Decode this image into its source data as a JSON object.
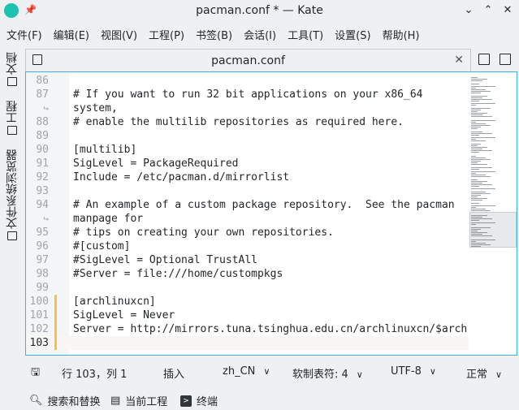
{
  "window": {
    "title": "pacman.conf * — Kate",
    "controls": [
      "minimize",
      "maximize",
      "close"
    ]
  },
  "menu": [
    "文件(F)",
    "编辑(E)",
    "视图(V)",
    "工程(P)",
    "书签(B)",
    "会话(I)",
    "工具(T)",
    "设置(S)",
    "帮助(H)"
  ],
  "sidebar": {
    "items": [
      {
        "label": "文档",
        "icon": "document-icon"
      },
      {
        "label": "工程",
        "icon": "project-icon"
      },
      {
        "label": "文件系统浏览器",
        "icon": "folder-icon"
      }
    ]
  },
  "tab": {
    "title": "pacman.conf",
    "close": "✕"
  },
  "editor": {
    "lines": [
      {
        "num": "86",
        "text": ""
      },
      {
        "num": "87",
        "text": "# If you want to run 32 bit applications on your x86_64"
      },
      {
        "num": "↪",
        "text": "system,",
        "wrap": true
      },
      {
        "num": "88",
        "text": "# enable the multilib repositories as required here."
      },
      {
        "num": "89",
        "text": ""
      },
      {
        "num": "90",
        "text": "[multilib]"
      },
      {
        "num": "91",
        "text": "SigLevel = PackageRequired"
      },
      {
        "num": "92",
        "text": "Include = /etc/pacman.d/mirrorlist"
      },
      {
        "num": "93",
        "text": ""
      },
      {
        "num": "94",
        "text": "# An example of a custom package repository.  See the pacman"
      },
      {
        "num": "↪",
        "text": "manpage for",
        "wrap": true
      },
      {
        "num": "95",
        "text": "# tips on creating your own repositories."
      },
      {
        "num": "96",
        "text": "#[custom]"
      },
      {
        "num": "97",
        "text": "#SigLevel = Optional TrustAll"
      },
      {
        "num": "98",
        "text": "#Server = file:///home/custompkgs"
      },
      {
        "num": "99",
        "text": ""
      },
      {
        "num": "100",
        "text": "[archlinuxcn]",
        "modified": true
      },
      {
        "num": "101",
        "text": "SigLevel = Never",
        "modified": true
      },
      {
        "num": "102",
        "text": "Server = http://mirrors.tuna.tsinghua.edu.cn/archlinuxcn/$arch",
        "modified": true
      },
      {
        "num": "103",
        "text": "",
        "modified": true,
        "current": true
      }
    ],
    "modified_color": "#f6c147",
    "accent_color": "#3daee9"
  },
  "status": {
    "position": "行 103，列 1",
    "mode": "插入",
    "language": "zh_CN",
    "indent": "软制表符: 4",
    "encoding": "UTF-8",
    "highlight": "正常"
  },
  "bottom": {
    "search": "搜索和替换",
    "project": "当前工程",
    "terminal": "终端"
  }
}
